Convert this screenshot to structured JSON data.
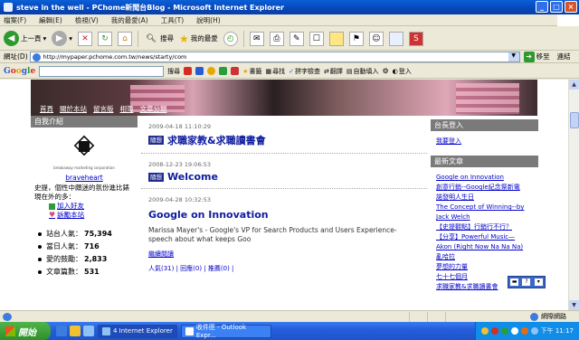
{
  "window": {
    "title": "steve in the well - PChome新聞台Blog - Microsoft Internet Explorer",
    "minimize": "_",
    "maximize": "□",
    "close": "×"
  },
  "menu": [
    "檔案(F)",
    "編輯(E)",
    "檢視(V)",
    "我的最愛(A)",
    "工具(T)",
    "說明(H)"
  ],
  "toolbar": {
    "back": "上一頁",
    "search": "搜尋",
    "favorites": "我的最愛"
  },
  "address": {
    "label": "網址(D)",
    "url": "http://mypaper.pchome.com.tw/news/starty/com",
    "go": "移至",
    "links": "連結"
  },
  "googlebar": {
    "search_btn": "搜尋",
    "bookmarks": "書籤",
    "find": "尋找",
    "spellcheck": "拼字檢查",
    "translate": "翻譯",
    "autofill": "自動填入",
    "signin": "登入"
  },
  "page": {
    "nav": [
      "首頁",
      "關於本站",
      "留言版",
      "相簿",
      "文章分類"
    ],
    "left": {
      "header": "自我介紹",
      "logo_sub": "breakaway marketing corporation",
      "username": "braveheart",
      "bio": "史提，個性中頗迷的氛份進比錶現在外的多：",
      "add_friend": "加入好友",
      "follow": "訴勵本站",
      "stats": [
        {
          "label": "站台人氣：",
          "value": "75,394"
        },
        {
          "label": "當日人氣：",
          "value": "716"
        },
        {
          "label": "愛的鼓勵：",
          "value": "2,833"
        },
        {
          "label": "文章篇數：",
          "value": "531"
        }
      ]
    },
    "posts": [
      {
        "date": "2009-04-18 11:10:29",
        "tag": "隨想",
        "title": "求職家教&求職讀書會"
      },
      {
        "date": "2008-12-23 19:06:53",
        "tag": "隨想",
        "title": "Welcome"
      },
      {
        "date": "2009-04-28 10:32:53",
        "title": "Google on Innovation",
        "body": "Marissa Mayer's - Google's VP for Search Products and Users Experience- speech about what keeps Goo",
        "more": "繼續閱讀",
        "meta": "人氣(31) | 回應(0) | 推薦(0) |"
      }
    ],
    "right": {
      "login_header": "台長登入",
      "login_link": "我要登入",
      "recent_header": "最新文章",
      "recent": [
        "Google on Innovation",
        "創意行銷--Google紀念祭新電",
        "諾發明人生日",
        "The Concept of Winning--by",
        "Jack Welch",
        "【史提觀點】行銷行不行？",
        "【分享】Powerful Music—",
        "Akon (Right Now Na Na Na)",
        "亂哈拉",
        "夢想的力量",
        "七十七個月",
        "求職家教&求職讀書會"
      ]
    }
  },
  "statusbar": {
    "zone": "網際網路"
  },
  "taskbar": {
    "start": "開始",
    "tasks": [
      "4 Internet Explorer",
      "收件匣 - Outlook Expr..."
    ],
    "clock": "下午 11:17"
  }
}
